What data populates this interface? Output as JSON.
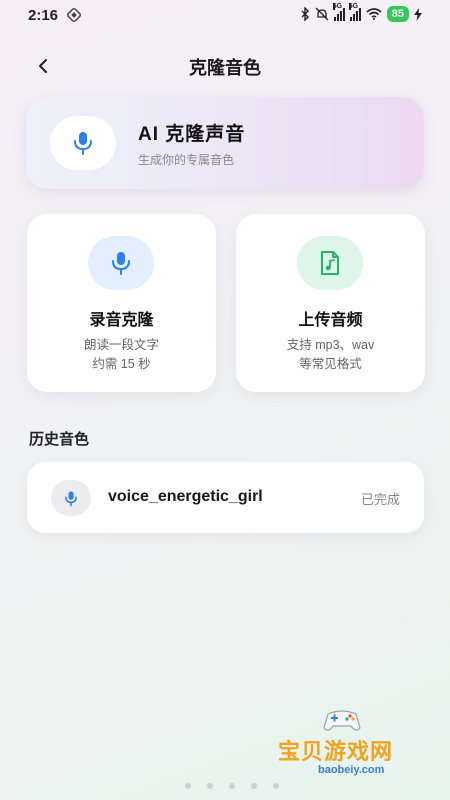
{
  "status_bar": {
    "time": "2:16",
    "signal_label_1": "5G",
    "signal_label_2": "5G",
    "battery": "85"
  },
  "header": {
    "title": "克隆音色"
  },
  "ai_card": {
    "title": "AI 克隆声音",
    "subtitle": "生成你的专属音色"
  },
  "options": [
    {
      "title": "录音克隆",
      "desc_line1": "朗读一段文字",
      "desc_line2": "约需 15 秒"
    },
    {
      "title": "上传音频",
      "desc_line1": "支持 mp3、wav",
      "desc_line2": "等常见格式"
    }
  ],
  "history": {
    "section_title": "历史音色",
    "items": [
      {
        "name": "voice_energetic_girl",
        "status": "已完成"
      }
    ]
  },
  "watermark": {
    "text": "宝贝游戏网",
    "url": "baobeiy.com"
  },
  "colors": {
    "accent_blue": "#2f7fe8",
    "accent_green": "#27b46a",
    "battery_green": "#34c759"
  }
}
